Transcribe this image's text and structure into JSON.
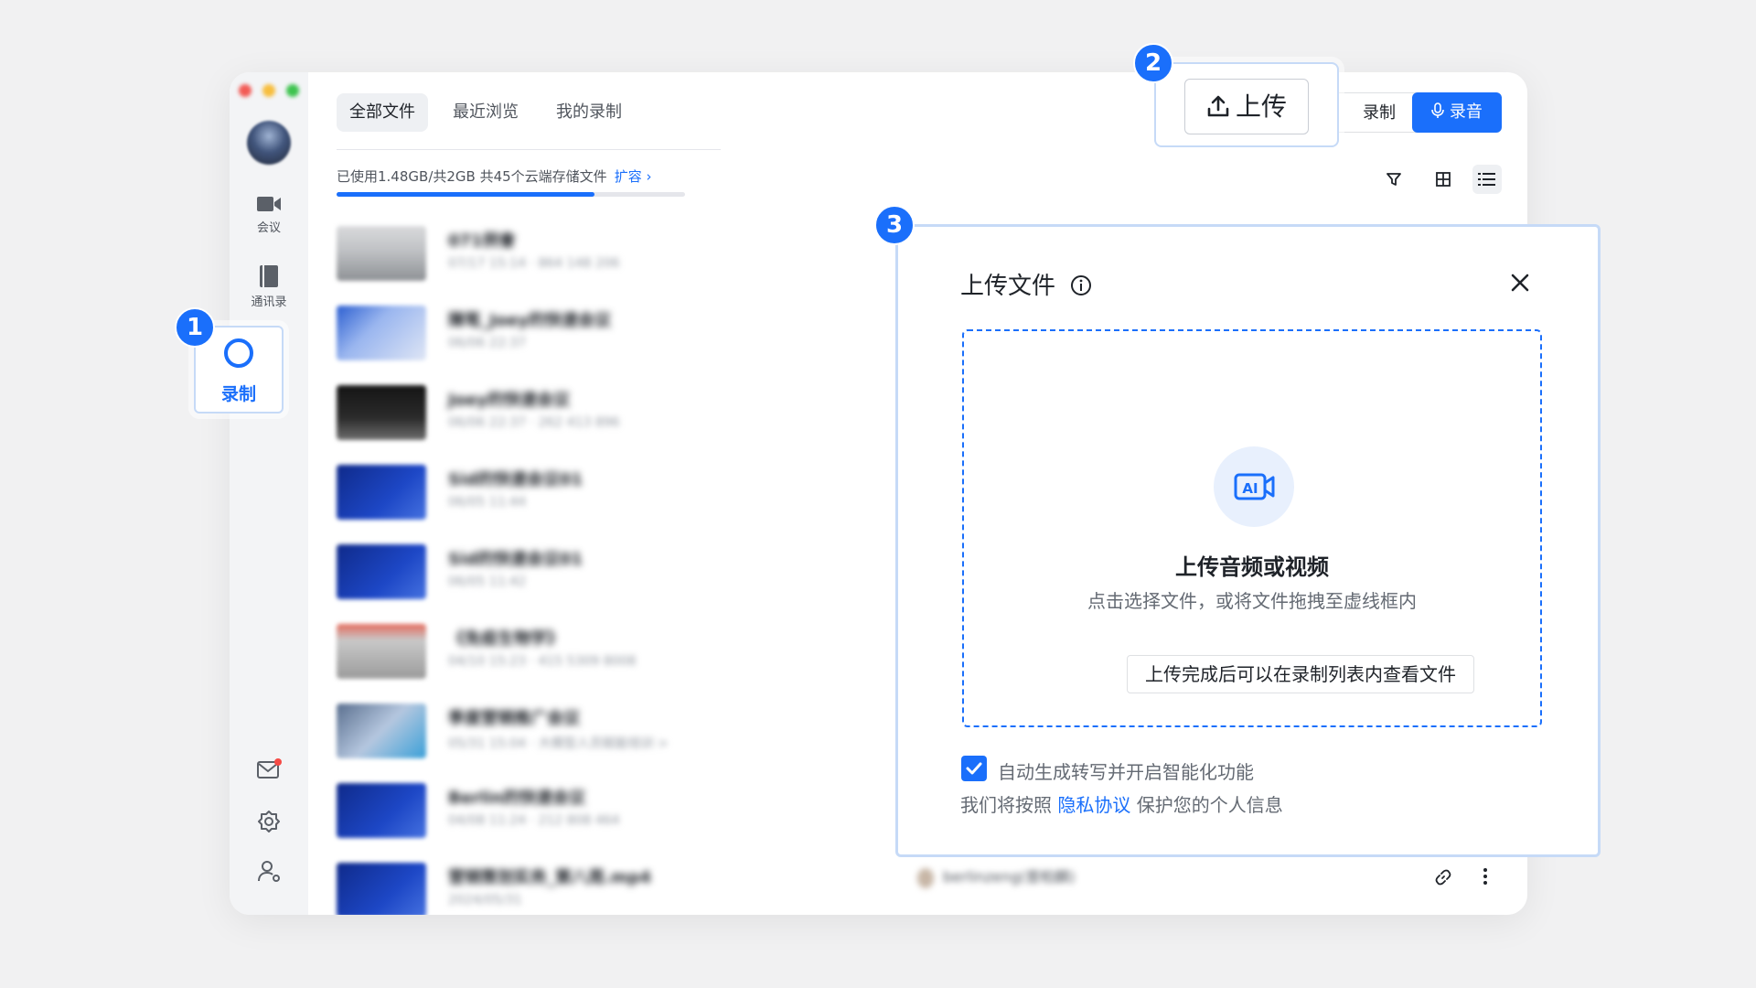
{
  "sidebar": {
    "items": [
      {
        "label": "会议",
        "icon": "video-camera-icon"
      },
      {
        "label": "通讯录",
        "icon": "contacts-book-icon"
      },
      {
        "label": "录制",
        "icon": "record-circle-icon"
      }
    ],
    "bottom_icons": [
      "mail-icon",
      "settings-gear-icon",
      "user-settings-icon"
    ]
  },
  "tabs": [
    {
      "label": "全部文件",
      "active": true
    },
    {
      "label": "最近浏览",
      "active": false
    },
    {
      "label": "我的录制",
      "active": false
    }
  ],
  "storage": {
    "text": "已使用1.48GB/共2GB  共45个云端存储文件",
    "expand_label": "扩容",
    "used_fraction": 0.74
  },
  "toolbar": {
    "upload_label": "上传",
    "record_label": "录制",
    "audio_label": "录音"
  },
  "files": [
    {
      "title": "071例會",
      "meta": "07/17 15:14 · 864 148 206"
    },
    {
      "title": "陳笔_Joey的快速会议",
      "meta": "06/06 22:37"
    },
    {
      "title": "Joey的快速会议",
      "meta": "06/06 22:37 · 262 413 896"
    },
    {
      "title": "Sid的快速会议01",
      "meta": "06/05 11:44"
    },
    {
      "title": "Sid的快速会议01",
      "meta": "06/05 11:42"
    },
    {
      "title": "《免疫生物学》",
      "meta": "04/10 15:23 · 415 5309 8008"
    },
    {
      "title": "季度营销推广会议",
      "meta": "05/31 15:04 · 大模型人员赋能培训 >"
    },
    {
      "title": "Berlin的快速会议",
      "meta": "04/08 11:24 · 212 808 464"
    },
    {
      "title": "营销策划实务_第八周.mp4",
      "meta": "2024/05/31"
    }
  ],
  "last_row_owner": "berlinzeng(曾柏麟)",
  "callouts": {
    "one": "1",
    "two": "2",
    "three": "3"
  },
  "dialog": {
    "title": "上传文件",
    "drop_heading": "上传音频或视频",
    "drop_hint": "点击选择文件，或将文件拖拽至虚线框内",
    "drop_note": "上传完成后可以在录制列表内查看文件",
    "checkbox_label": "自动生成转写并开启智能化功能",
    "checkbox_checked": true,
    "privacy_prefix": "我们将按照",
    "privacy_link": "隐私协议",
    "privacy_suffix": "保护您的个人信息",
    "ai_badge": "AI"
  },
  "colors": {
    "accent": "#1a6ffb",
    "notify": "#f54a45"
  }
}
